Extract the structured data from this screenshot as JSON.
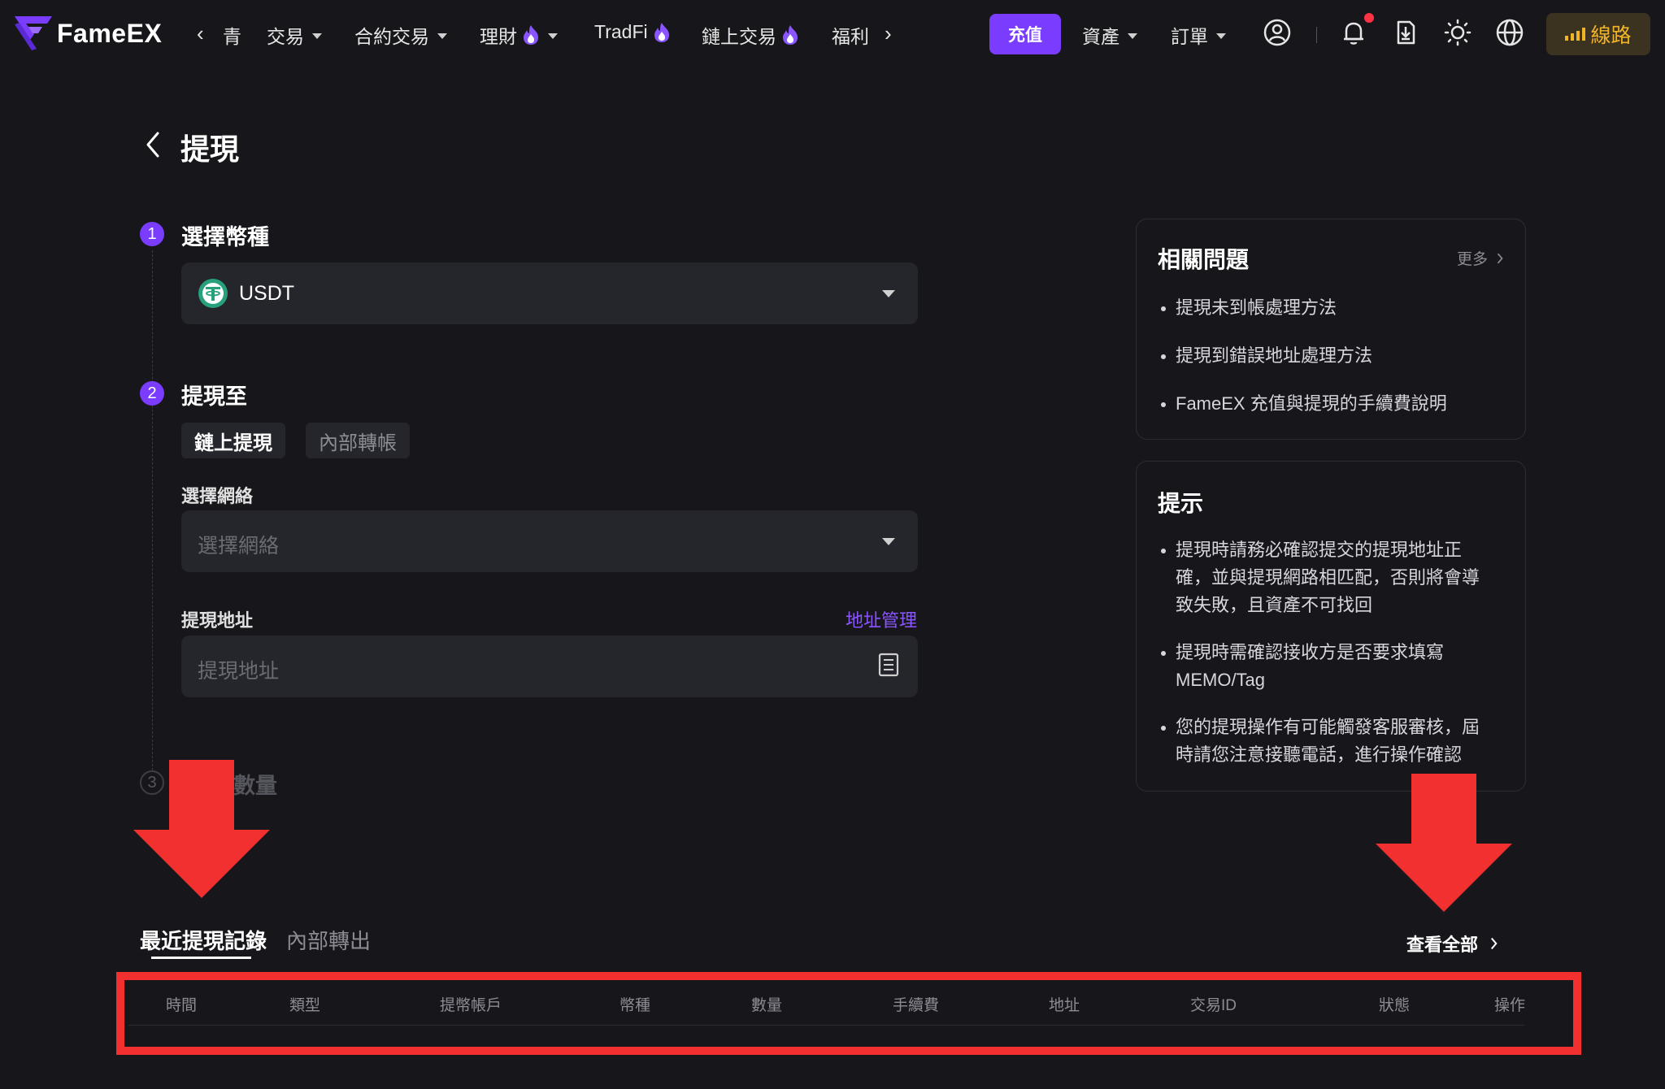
{
  "brand": {
    "name": "FameEX"
  },
  "nav": {
    "truncated_item": "青",
    "items": [
      {
        "label": "交易",
        "dropdown": true,
        "hot": false
      },
      {
        "label": "合約交易",
        "dropdown": true,
        "hot": false
      },
      {
        "label": "理財",
        "dropdown": true,
        "hot": true
      },
      {
        "label": "TradFi",
        "dropdown": false,
        "hot": true
      },
      {
        "label": "鏈上交易",
        "dropdown": false,
        "hot": true
      },
      {
        "label": "福利",
        "dropdown": false,
        "hot": false
      }
    ],
    "deposit_button": "充值",
    "assets": "資產",
    "orders": "訂單",
    "line_button": "線路",
    "icons": [
      "user-icon",
      "bell-icon",
      "download-icon",
      "theme-icon",
      "globe-icon"
    ]
  },
  "page": {
    "title": "提現",
    "steps": [
      {
        "num": "1",
        "label": "選擇幣種"
      },
      {
        "num": "2",
        "label": "提現至"
      },
      {
        "num": "3",
        "label": "數量"
      }
    ],
    "coin": {
      "selected": "USDT",
      "icon": "tether-icon"
    },
    "withdraw_tabs": {
      "active": "鏈上提現",
      "inactive": "內部轉帳"
    },
    "network": {
      "label": "選擇網絡",
      "placeholder": "選擇網絡"
    },
    "address": {
      "label": "提現地址",
      "placeholder": "提現地址",
      "manage_link": "地址管理"
    }
  },
  "faq_panel": {
    "title": "相關問題",
    "more": "更多",
    "items": [
      "提現未到帳處理方法",
      "提現到錯誤地址處理方法",
      "FameEX 充值與提現的手續費說明"
    ]
  },
  "tips_panel": {
    "title": "提示",
    "items": [
      "提現時請務必確認提交的提現地址正確，並與提現網路相匹配，否則將會導致失敗，且資產不可找回",
      "提現時需確認接收方是否要求填寫MEMO/Tag",
      "您的提現操作有可能觸發客服審核，屆時請您注意接聽電話，進行操作確認"
    ]
  },
  "records": {
    "tabs": {
      "active": "最近提現記錄",
      "inactive": "內部轉出"
    },
    "view_all": "查看全部",
    "columns": [
      "時間",
      "類型",
      "提幣帳戶",
      "幣種",
      "數量",
      "手續費",
      "地址",
      "交易ID",
      "狀態",
      "操作"
    ]
  },
  "colors": {
    "accent": "#7a3cff",
    "background": "#17171b",
    "annotation_red": "#f23030",
    "line_gold": "#f0b429"
  }
}
